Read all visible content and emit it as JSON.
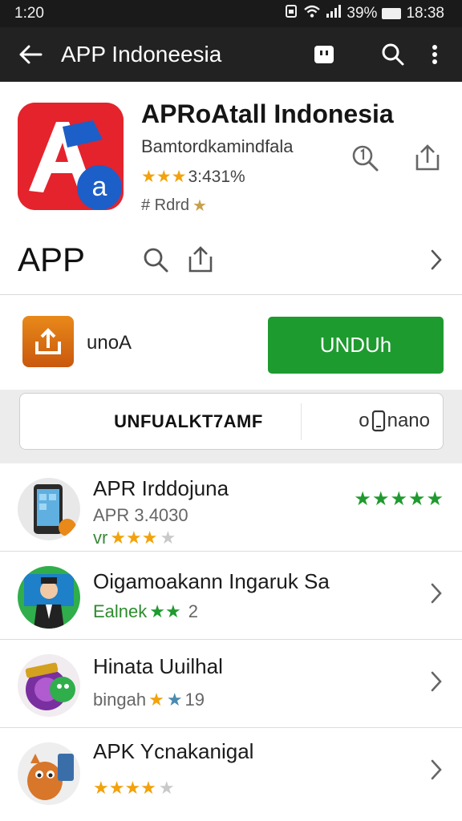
{
  "status_bar": {
    "time": "1:20",
    "battery": "39%",
    "clock_right": "18:38"
  },
  "app_bar": {
    "title": "APP Indoneesia"
  },
  "hero": {
    "title": "APRoAtall Indonesia",
    "developer": "Bamtordkamindfala",
    "stars": "★★★",
    "rating_text": "3:431%",
    "tag_text": "# Rdrd",
    "tag_star": "★"
  },
  "section": {
    "label": "APP"
  },
  "download": {
    "label": "unoA",
    "button_label": "UNDUh"
  },
  "promo": {
    "label": "UNFUALKT7AMF",
    "right_text": "nano",
    "right_prefix": "o"
  },
  "list": [
    {
      "title": "APR Irddojuna",
      "subtitle": "APR 3.4030",
      "rating_prefix": "vr",
      "stars_gold": "★★★",
      "stars_grey": "★",
      "right_stars": "★★★★★"
    },
    {
      "title": "Oigamoakann Ingaruk Sa",
      "rating_prefix": "Ealnek",
      "stars_green": "★★",
      "count": "2"
    },
    {
      "title": "Hinata Uuilhal",
      "rating_prefix": "bingah",
      "stars_gold": "★",
      "stars_blue": "★",
      "count": "19"
    },
    {
      "title": "APK Ycnakanigal",
      "stars_gold": "★★★★",
      "stars_grey": "★"
    }
  ]
}
